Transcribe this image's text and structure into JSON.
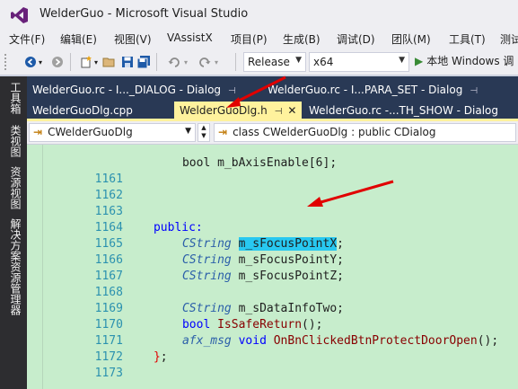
{
  "window": {
    "title": "WelderGuo - Microsoft Visual Studio"
  },
  "menu": [
    "文件(F)",
    "编辑(E)",
    "视图(V)",
    "VAssistX",
    "项目(P)",
    "生成(B)",
    "调试(D)",
    "团队(M)",
    "工具(T)",
    "测试"
  ],
  "toolbar": {
    "configuration": "Release",
    "platform": "x64",
    "run_label": "本地 Windows 调"
  },
  "sidebar": [
    "工具箱",
    "类视图",
    "资源视图",
    "解决方案资源管理器"
  ],
  "tabs": {
    "row1": [
      {
        "label": "WelderGuo.rc - I..._DIALOG - Dialog",
        "pin": "⊣"
      },
      {
        "label": "WelderGuo.rc - I...PARA_SET - Dialog",
        "pin": "⊣"
      }
    ],
    "row2": [
      {
        "label": "WelderGuoDlg.cpp"
      },
      {
        "label": "WelderGuoDlg.h",
        "pin": "⊣",
        "close": "✕"
      },
      {
        "label": "WelderGuo.rc -...TH_SHOW - Dialog"
      }
    ]
  },
  "navigation": {
    "class_combo": "CWelderGuoDlg",
    "member_combo": "class CWelderGuoDlg : public CDialog"
  },
  "code": {
    "partial_top": "bool m_bAxisEnable[6];",
    "lines": [
      {
        "n": "1161",
        "text": ""
      },
      {
        "n": "1162",
        "text": ""
      },
      {
        "n": "1163",
        "text": ""
      },
      {
        "n": "1164",
        "kw": "public:"
      },
      {
        "n": "1165",
        "type": "CString",
        "var": "m_sFocusPointX",
        "tail": ";"
      },
      {
        "n": "1166",
        "type": "CString",
        "var": "m_sFocusPointY",
        "tail": ";"
      },
      {
        "n": "1167",
        "type": "CString",
        "var": "m_sFocusPointZ",
        "tail": ";"
      },
      {
        "n": "1168",
        "text": ""
      },
      {
        "n": "1169",
        "type": "CString",
        "var": "m_sDataInfoTwo",
        "tail": ";"
      },
      {
        "n": "1170",
        "kw2": "bool",
        "fn": "IsSafeReturn",
        "tail": "();"
      },
      {
        "n": "1171",
        "type": "afx_msg",
        "kw2": "void",
        "fn": "OnBnClickedBtnProtectDoorOpen",
        "tail": "();"
      },
      {
        "n": "1172",
        "brace": "};"
      },
      {
        "n": "1173",
        "text": ""
      }
    ]
  },
  "colors": {
    "accent_tab": "#fff29d",
    "editor_bg": "#c7edcc",
    "highlight": "#28c8f0",
    "annotation_arrow": "#e10000"
  }
}
